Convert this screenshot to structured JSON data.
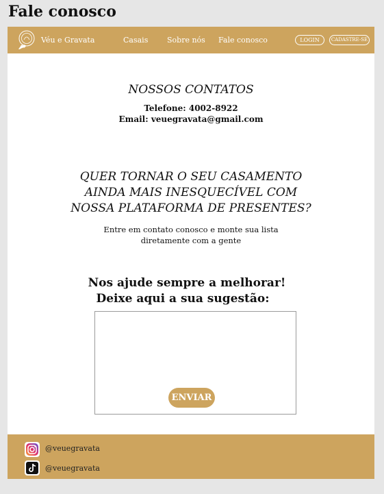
{
  "page": {
    "title": "Fale conosco"
  },
  "navbar": {
    "brand": "Véu e Gravata",
    "links": [
      "Casais",
      "Sobre nós",
      "Fale conosco"
    ],
    "login": "LOGIN",
    "signup": "CADASTRE-SE"
  },
  "contacts": {
    "heading": "NOSSOS CONTATOS",
    "phone": "Telefone: 4002-8922",
    "email": "Email: veuegravata@gmail.com"
  },
  "cta": {
    "lines": [
      "QUER TORNAR O SEU CASAMENTO",
      "AINDA MAIS INESQUECÍVEL COM",
      "NOSSA PLATAFORMA DE PRESENTES?"
    ],
    "sub_lines": [
      "Entre em contato conosco e monte sua lista",
      "diretamente com a gente"
    ]
  },
  "suggestion": {
    "line1": "Nos ajude sempre a melhorar!",
    "line2": "Deixe aqui a sua sugestão:",
    "value": "",
    "button": "ENVIAR"
  },
  "footer": {
    "instagram": {
      "icon": "instagram-icon",
      "handle": "@veuegravata"
    },
    "tiktok": {
      "icon": "tiktok-icon",
      "handle": "@veuegravata"
    }
  },
  "colors": {
    "accent": "#cda45e",
    "background": "#e6e6e6",
    "content": "#ffffff"
  }
}
